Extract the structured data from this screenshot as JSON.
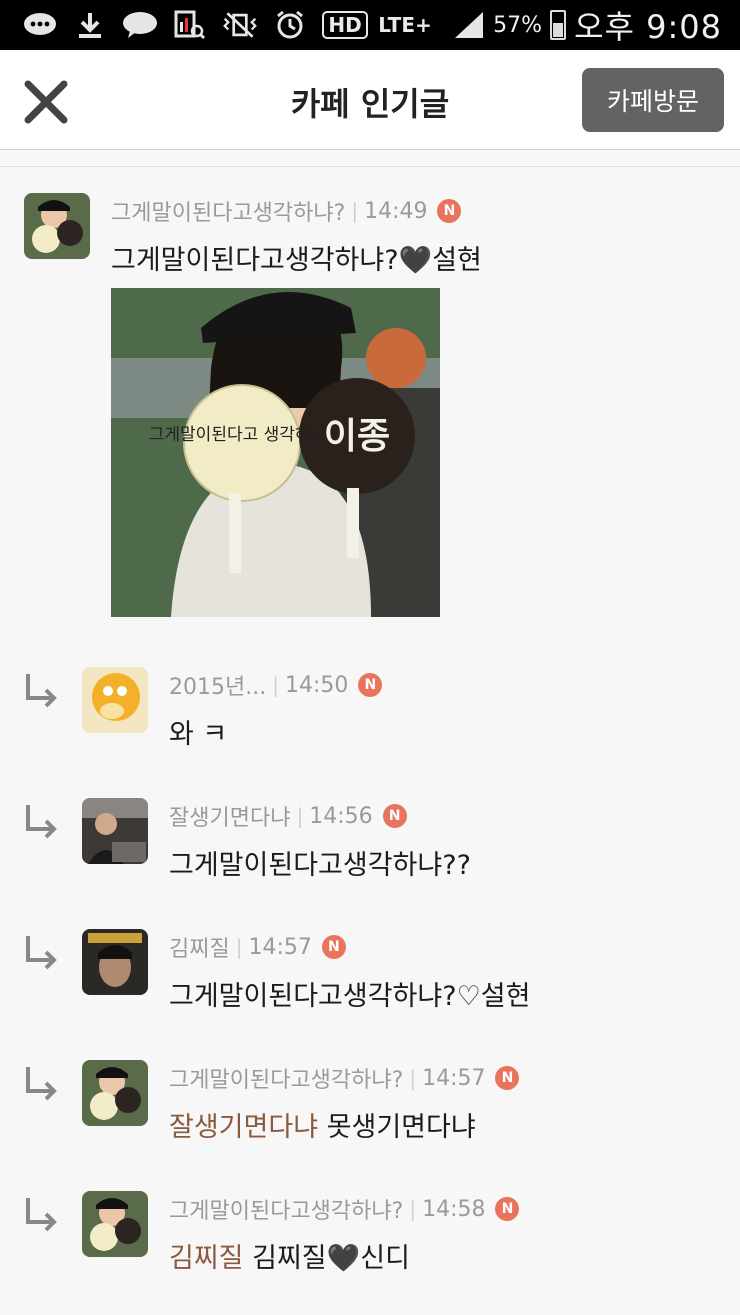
{
  "status_bar": {
    "battery_percent": "57%",
    "time": "오후 9:08",
    "talk_label": "TALK",
    "hd_label": "HD",
    "network_label": "LTE+",
    "icons": [
      "message-icon",
      "download-icon",
      "kakao-talk-icon",
      "search-chart-icon",
      "vibrate-mute-icon",
      "alarm-icon",
      "hd-icon",
      "lte-icon",
      "signal-icon",
      "battery-icon"
    ]
  },
  "header": {
    "title": "카페 인기글",
    "visit_button": "카페방문",
    "close_icon": "close-icon"
  },
  "post": {
    "author": "그게말이된다고생각하냐?",
    "time": "14:49",
    "badge": "N",
    "text": "그게말이된다고생각하냐?🖤설현",
    "image_sign_left": "그게말이된다고 생각하냐?",
    "image_sign_right": "이종"
  },
  "replies": [
    {
      "author": "2015년...",
      "time": "14:50",
      "badge": "N",
      "mention": "",
      "text": "와 ㅋ"
    },
    {
      "author": "잘생기면다냐",
      "time": "14:56",
      "badge": "N",
      "mention": "",
      "text": "그게말이된다고생각하냐??"
    },
    {
      "author": "김찌질",
      "time": "14:57",
      "badge": "N",
      "mention": "",
      "text": "그게말이된다고생각하냐?♡설현"
    },
    {
      "author": "그게말이된다고생각하냐?",
      "time": "14:57",
      "badge": "N",
      "mention": "잘생기면다냐",
      "text": "못생기면다냐"
    },
    {
      "author": "그게말이된다고생각하냐?",
      "time": "14:58",
      "badge": "N",
      "mention": "김찌질",
      "text": "김찌질🖤신디"
    }
  ],
  "colors": {
    "badge": "#e8745c",
    "mention": "#8b5a3c",
    "visit_button": "#636363"
  }
}
